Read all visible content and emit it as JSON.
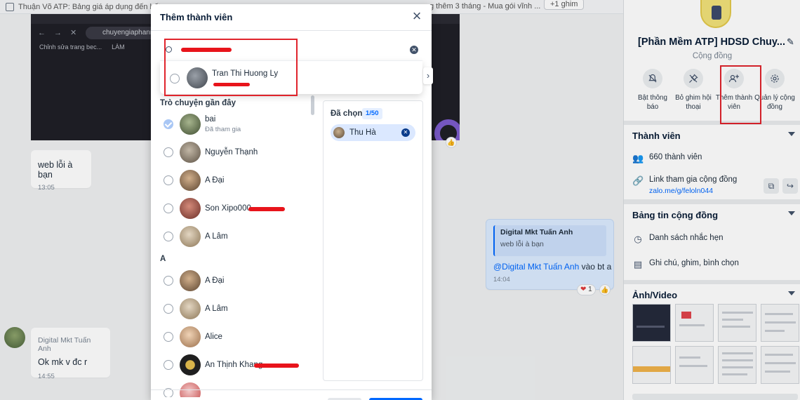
{
  "chat": {
    "top_text": "Thuận Võ ATP: Bảng giá áp dụng đến hết",
    "top_text_right": "g thêm 3 tháng - Mua gói vĩnh ...",
    "pin_button": "+1 ghim",
    "screenshot_url": "chuyengiaphanm",
    "screenshot_bookmark": "Chỉnh sửa trang bec...",
    "screenshot_bookmark2": "LÀM",
    "messages": [
      {
        "text": "web lỗi à bạn",
        "time": "13:05"
      },
      {
        "sender": "Digital Mkt Tuấn Anh",
        "text": "Ok mk v đc r",
        "time": "14:55"
      }
    ],
    "reply": {
      "quote_name": "Digital Mkt Tuấn Anh",
      "quote_text": "web lỗi à bạn",
      "mention": "@Digital Mkt Tuấn Anh",
      "text": " vào bt a",
      "time": "14:04",
      "reaction_count": "1"
    }
  },
  "panel": {
    "group_name": "[Phần Mềm ATP] HDSD Chuy...",
    "group_type": "Cộng đồng",
    "actions": [
      {
        "label": "Bật thông báo",
        "icon": "bell-off-icon"
      },
      {
        "label": "Bỏ ghim hội thoại",
        "icon": "unpin-icon"
      },
      {
        "label": "Thêm thành viên",
        "icon": "add-member-icon"
      },
      {
        "label": "Quản lý cộng đồng",
        "icon": "gear-icon"
      }
    ],
    "members_title": "Thành viên",
    "members_count": "660 thành viên",
    "invite_label": "Link tham gia cộng đồng",
    "invite_link": "zalo.me/g/feloln044",
    "bulletin_title": "Bảng tin cộng đồng",
    "bulletin_items": [
      "Danh sách nhắc hẹn",
      "Ghi chú, ghim, bình chọn"
    ],
    "media_title": "Ảnh/Video"
  },
  "modal": {
    "title": "Thêm thành viên",
    "search_result": "Tran Thi Huong Ly",
    "recent_title": "Trò chuyện gần đây",
    "recent": [
      {
        "name": "bai",
        "sub": "Đã tham gia",
        "checked": true
      },
      {
        "name": "Nguyễn Thạnh",
        "sub": ""
      },
      {
        "name": "A Đại",
        "sub": ""
      },
      {
        "name": "Son Xipo000",
        "sub": ""
      },
      {
        "name": "A Lâm",
        "sub": ""
      }
    ],
    "section_a": "A",
    "a_list": [
      {
        "name": "A Đại"
      },
      {
        "name": "A Lâm"
      },
      {
        "name": "Alice"
      },
      {
        "name": "An Thịnh Khang"
      }
    ],
    "selected_title": "Đã chọn",
    "selected_count": "1/50",
    "selected": [
      {
        "name": "Thu Hà"
      }
    ]
  },
  "colors": {
    "accent": "#0068ff",
    "highlight": "#e0242c"
  }
}
